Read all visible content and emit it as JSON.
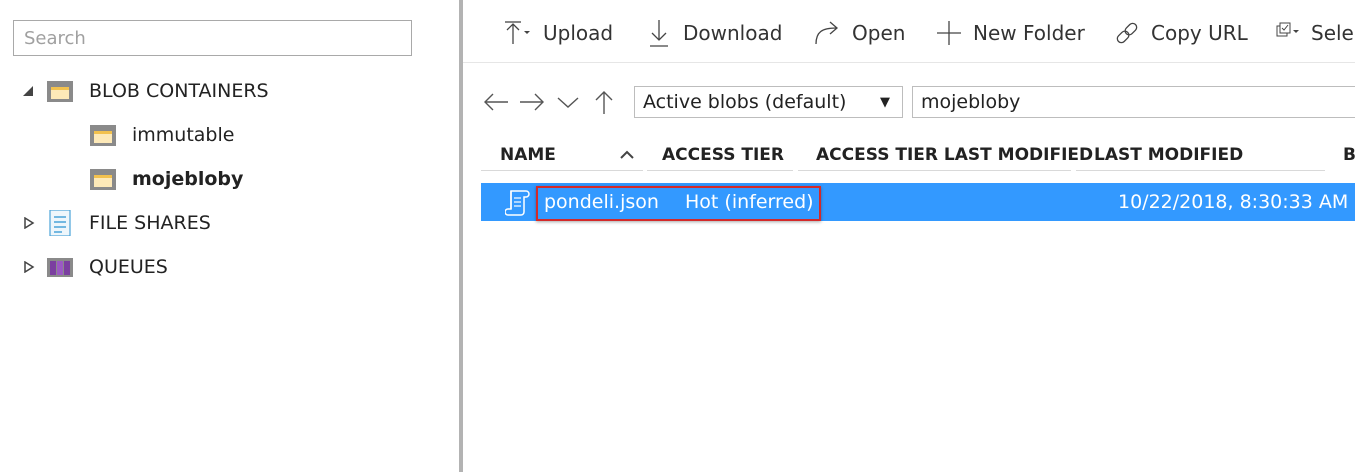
{
  "search": {
    "placeholder": "Search"
  },
  "tree": {
    "blob_containers": {
      "label": "BLOB CONTAINERS",
      "children": [
        {
          "label": "immutable"
        },
        {
          "label": "mojebloby"
        }
      ]
    },
    "file_shares": {
      "label": "FILE SHARES"
    },
    "queues": {
      "label": "QUEUES"
    }
  },
  "toolbar": {
    "upload": "Upload",
    "download": "Download",
    "open": "Open",
    "new_folder": "New Folder",
    "copy_url": "Copy URL",
    "select": "Selec"
  },
  "filter": {
    "selected": "Active blobs (default)"
  },
  "path": {
    "value": "mojebloby"
  },
  "columns": {
    "name": "NAME",
    "access_tier": "ACCESS TIER",
    "access_tier_modified": "ACCESS TIER LAST MODIFIED",
    "last_modified": "LAST MODIFIED",
    "next": "B"
  },
  "rows": [
    {
      "name": "pondeli.json",
      "access_tier": "Hot (inferred)",
      "last_modified": "10/22/2018, 8:30:33 AM"
    }
  ],
  "colors": {
    "selection": "#3399ff",
    "highlight_border": "#d42a2a",
    "splitter": "#b3b3b3"
  }
}
